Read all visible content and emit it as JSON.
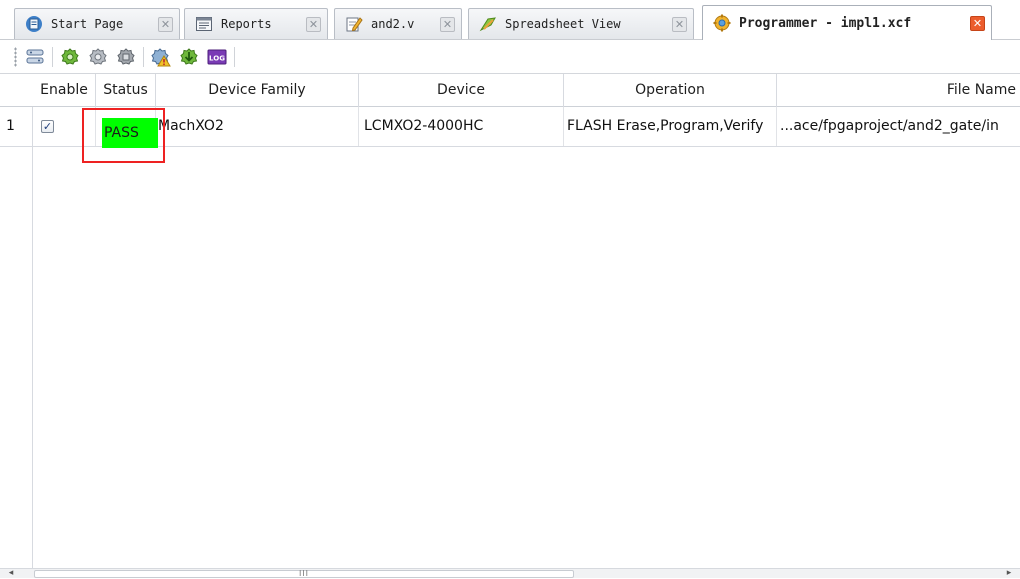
{
  "tabs": [
    {
      "label": "Start Page",
      "icon": "start-page-icon",
      "active": false
    },
    {
      "label": "Reports",
      "icon": "reports-icon",
      "active": false
    },
    {
      "label": "and2.v",
      "icon": "verilog-file-icon",
      "active": false
    },
    {
      "label": "Spreadsheet View",
      "icon": "spreadsheet-icon",
      "active": false
    },
    {
      "label": "Programmer - impl1.xcf",
      "icon": "programmer-icon",
      "active": true
    }
  ],
  "toolbar": {
    "buttons": [
      {
        "icon": "cable-setup-icon"
      },
      {
        "icon": "program-device-icon"
      },
      {
        "icon": "scan-device-icon"
      },
      {
        "icon": "detect-cable-icon"
      },
      {
        "icon": "device-error-icon"
      },
      {
        "icon": "download-icon"
      },
      {
        "icon": "log-icon",
        "text": "LOG"
      }
    ]
  },
  "grid": {
    "columns": [
      "Enable",
      "Status",
      "Device Family",
      "Device",
      "Operation",
      "File Name"
    ],
    "rows": [
      {
        "index": "1",
        "enable_checked": true,
        "status": "PASS",
        "device_family": "MachXO2",
        "device": "LCMXO2-4000HC",
        "operation": "FLASH Erase,Program,Verify",
        "file_name": "...ace/fpgaproject/and2_gate/in"
      }
    ]
  },
  "colors": {
    "pass_bg": "#00ff00",
    "highlight_border": "#ee2222",
    "active_close": "#ec5d2d"
  },
  "scrollbar": {
    "thumb_grip": "III"
  }
}
